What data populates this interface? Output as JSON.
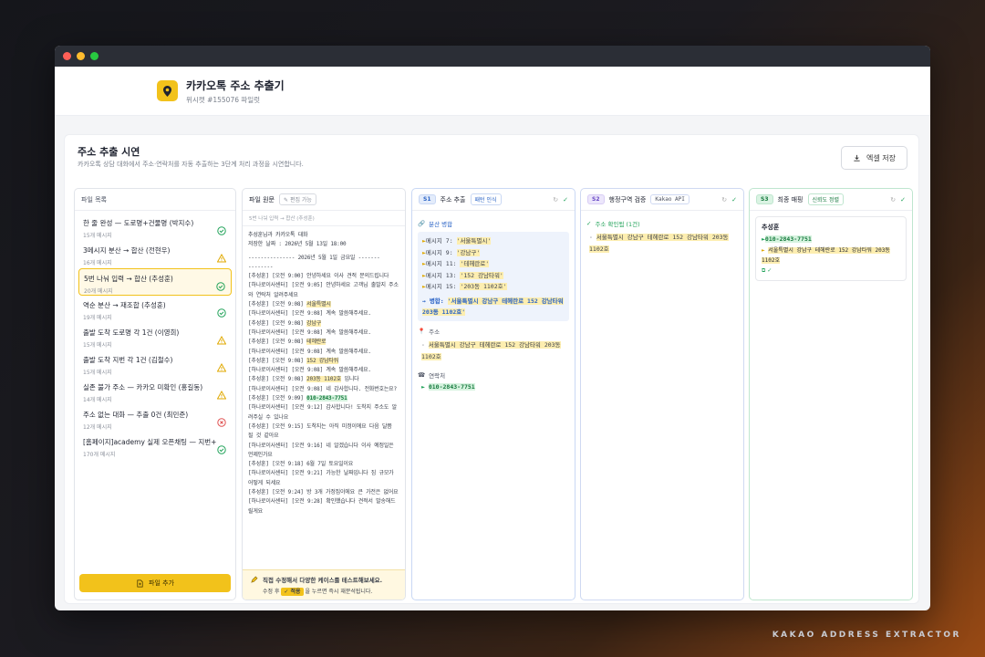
{
  "app": {
    "title": "카카오톡 주소 추출기",
    "subtitle": "위시캣 #155076 파일럿"
  },
  "section": {
    "title": "주소 추출 시연",
    "description": "카카오톡 상담 대화에서 주소·연락처를 자동 추출하는 3단계 처리 과정을 시연합니다.",
    "excel_label": "엑셀 저장"
  },
  "files": {
    "header": "파일 목록",
    "items": [
      {
        "name": "한 줄 완성 — 도로명+건물명 (박지수)",
        "count": "15개 메시지",
        "status": "ok"
      },
      {
        "name": "3메시지 분산 → 합산 (전현우)",
        "count": "16개 메시지",
        "status": "warn"
      },
      {
        "name": "5번 나눠 입력 → 합산 (추성훈)",
        "count": "20개 메시지",
        "status": "ok"
      },
      {
        "name": "역순 분산 → 재조합 (추성훈)",
        "count": "19개 메시지",
        "status": "ok"
      },
      {
        "name": "출발 도착 도로명 각 1건 (이영희)",
        "count": "15개 메시지",
        "status": "warn"
      },
      {
        "name": "출발 도착 지번 각 1건 (김철수)",
        "count": "15개 메시지",
        "status": "warn"
      },
      {
        "name": "실존 불가 주소 — 카카오 미확인 (홍길동)",
        "count": "14개 메시지",
        "status": "warn"
      },
      {
        "name": "주소 없는 대화 — 추출 0건 (최민준)",
        "count": "12개 메시지",
        "status": "error"
      },
      {
        "name": "[홈페이지]academy 실제 오픈채팅 — 지번+...",
        "count": "170개 메시지",
        "status": "ok"
      }
    ],
    "add_label": "파일 추가"
  },
  "original": {
    "header": "파일 원문",
    "edit_tag": "편집 가능",
    "sub": "5번 나눠 입력 → 합산 (추성훈)",
    "lines": [
      "추성훈님과 카카오톡 대화",
      "저장한 날짜 : 2026년 5월 13일 18:00",
      "",
      "--------------- 2026년 5월 1일 금요일 -------",
      "--------",
      "[추성훈] [오전 9:00] 안녕하세요 이사 견적 문의드립니다",
      "[하나로이사센터] [오전 9:05] 안녕하세요 고객님 출발지 주소와 연락처 알려주세요",
      "[추성훈] [오전 9:08] |서울특별시|",
      "[하나로이사센터] [오전 9:08] 계속 말씀해주세요.",
      "[추성훈] [오전 9:08] |강남구|",
      "[하나로이사센터] [오전 9:08] 계속 말씀해주세요.",
      "[추성훈] [오전 9:08] |테헤란로|",
      "[하나로이사센터] [오전 9:08] 계속 말씀해주세요.",
      "[추성훈] [오전 9:08] |152 강남타워|",
      "[하나로이사센터] [오전 9:08] 계속 말씀해주세요.",
      "[추성훈] [오전 9:08] |203동 1102호| 입니다",
      "[하나로이사센터] [오전 9:08] 네 감사합니다. 전화번호는요?",
      "[추성훈] [오전 9:09] #010-2843-7751#",
      "[하나로이사센터] [오전 9:12] 감사합니다! 도착지 주소도 알려주실 수 있나요",
      "[추성훈] [오전 9:15] 도착지는 아직 미정이에요 다음 달쯤 될 것 같아요",
      "[하나로이사센터] [오전 9:16] 네 알겠습니다 이사 예정일은 언제인가요",
      "[추성훈] [오전 9:18] 6월 7일 토요일이요",
      "[하나로이사센터] [오전 9:21] 가능한 날짜입니다 짐 규모가 어떻게 되세요",
      "[추성훈] [오전 9:24] 방 3개 가정집이에요 큰 가전은 없어요",
      "[하나로이사센터] [오전 9:28] 확인했습니다 견적서 발송해드릴게요"
    ],
    "footer_title": "직접 수정해서 다양한 케이스를 테스트해보세요.",
    "footer_text_a": "수정 후",
    "footer_btn": "적용",
    "footer_text_b": "을 누르면 즉시 재분석됩니다."
  },
  "s1": {
    "badge": "S1",
    "title": "주소 추출",
    "tag": "패턴 인식",
    "group_label": "분산 병합",
    "messages": [
      {
        "label": "메시지 7:",
        "value": "'서울특별시'"
      },
      {
        "label": "메시지 9:",
        "value": "'강남구'"
      },
      {
        "label": "메시지 11:",
        "value": "'테헤란로'"
      },
      {
        "label": "메시지 13:",
        "value": "'152 강남타워'"
      },
      {
        "label": "메시지 15:",
        "value": "'203동 1102호'"
      }
    ],
    "merge_prefix": "→ 병합:",
    "merged": "'서울특별시 강남구 테헤란로 152 강남타워 203동 1102호'",
    "address_label": "주소",
    "address": "서울특별시 강남구 테헤란로 152 강남타워 203동 1102호",
    "contact_label": "연락처",
    "phone": "010-2843-7751"
  },
  "s2": {
    "badge": "S2",
    "title": "행정구역 검증",
    "tag": "Kakao API",
    "confirmed_label": "주소 확인됨 (1건)",
    "address": "서울특별시 강남구 테헤란로 152 강남타워 203동 1102호"
  },
  "s3": {
    "badge": "S3",
    "title": "최종 매핑",
    "tag": "신뢰도 정렬",
    "name": "추성훈",
    "phone": "010-2843-7751",
    "address": "서울특별시 강남구 테헤란로 152 강남타워 203동 1102호"
  },
  "watermark": "KAKAO ADDRESS EXTRACTOR",
  "colors": {
    "accent": "#f2c21b",
    "ok": "#22a35a",
    "warn": "#e0a800",
    "error": "#e05252",
    "blue": "#2a63c6"
  }
}
